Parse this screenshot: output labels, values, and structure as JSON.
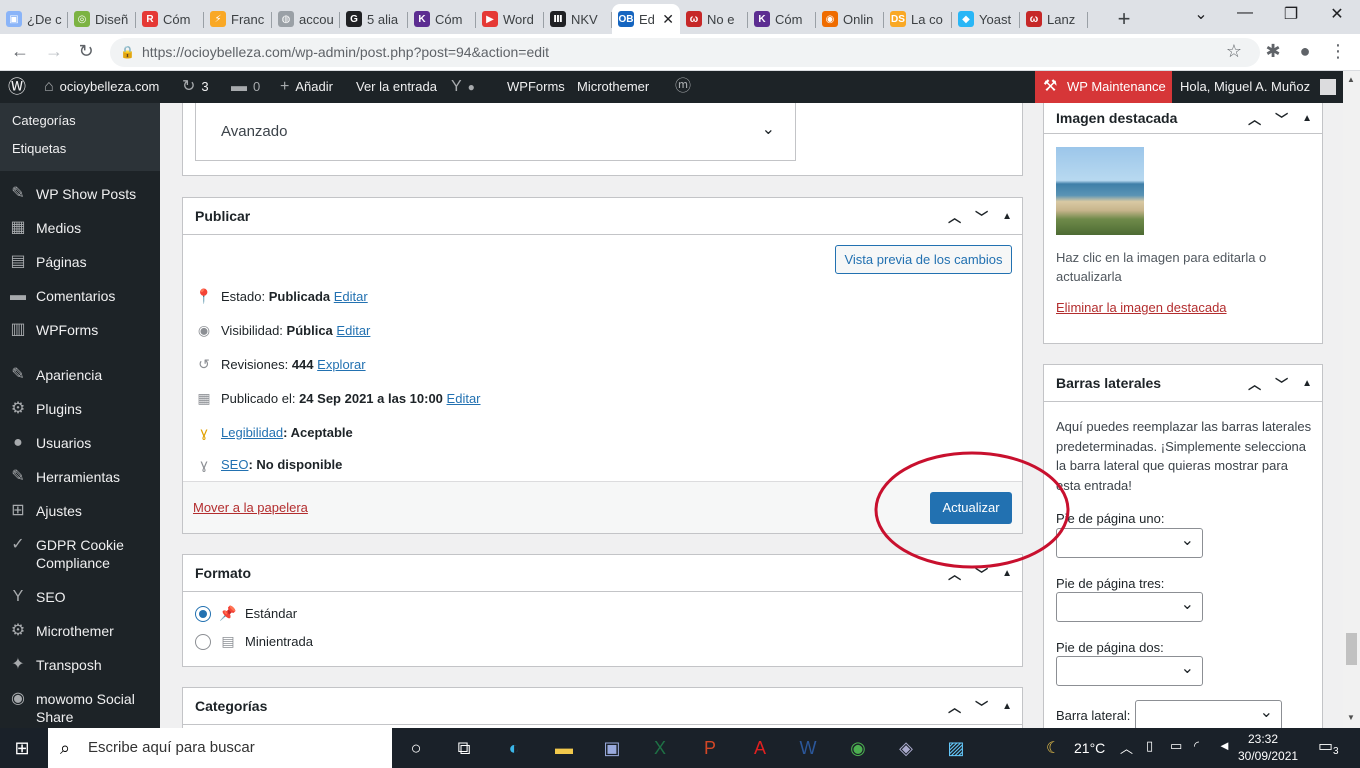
{
  "browser": {
    "tabs": [
      {
        "favicon_color": "#8ab4f8",
        "favicon_char": "▣",
        "title": "¿De c"
      },
      {
        "favicon_color": "#7cb342",
        "favicon_char": "◎",
        "title": "Diseñ"
      },
      {
        "favicon_color": "#e53935",
        "favicon_char": "R",
        "title": "Cóm"
      },
      {
        "favicon_color": "#f9a825",
        "favicon_char": "⚡",
        "title": "Franc"
      },
      {
        "favicon_color": "#9aa0a6",
        "favicon_char": "◍",
        "title": "accou"
      },
      {
        "favicon_color": "#202124",
        "favicon_char": "G",
        "title": "5 alia"
      },
      {
        "favicon_color": "#5c2d91",
        "favicon_char": "K",
        "title": "Cóm"
      },
      {
        "favicon_color": "#e53935",
        "favicon_char": "▶",
        "title": "Word"
      },
      {
        "favicon_color": "#202124",
        "favicon_char": "Ⅲ",
        "title": "NKV"
      },
      {
        "favicon_color": "#1565c0",
        "favicon_char": "OB",
        "title": "Ed"
      },
      {
        "favicon_color": "#c62828",
        "favicon_char": "ω",
        "title": "No e"
      },
      {
        "favicon_color": "#5c2d91",
        "favicon_char": "K",
        "title": "Cóm"
      },
      {
        "favicon_color": "#ef6c00",
        "favicon_char": "◉",
        "title": "Onlin"
      },
      {
        "favicon_color": "#f9a825",
        "favicon_char": "DS",
        "title": "La co"
      },
      {
        "favicon_color": "#29b6f6",
        "favicon_char": "◆",
        "title": "Yoast"
      },
      {
        "favicon_color": "#c62828",
        "favicon_char": "ω",
        "title": "Lanz"
      }
    ],
    "url": "https://ocioybelleza.com/wp-admin/post.php?post=94&action=edit"
  },
  "adminbar": {
    "site": "ocioybelleza.com",
    "updates": "3",
    "comments": "0",
    "add_new": "Añadir",
    "view_post": "Ver la entrada",
    "wpforms": "WPForms",
    "microthemer": "Microthemer",
    "maintenance": "WP Maintenance",
    "greeting": "Hola, Miguel A. Muñoz"
  },
  "sidebar": {
    "submenu": [
      "Categorías",
      "Etiquetas"
    ],
    "items": [
      {
        "icon": "✎",
        "label": "WP Show Posts"
      },
      {
        "icon": "▦",
        "label": "Medios"
      },
      {
        "icon": "▤",
        "label": "Páginas"
      },
      {
        "icon": "▬",
        "label": "Comentarios"
      },
      {
        "icon": "▥",
        "label": "WPForms"
      },
      {
        "icon": "✎",
        "label": "Apariencia"
      },
      {
        "icon": "⚙",
        "label": "Plugins"
      },
      {
        "icon": "●",
        "label": "Usuarios"
      },
      {
        "icon": "✎",
        "label": "Herramientas"
      },
      {
        "icon": "⊞",
        "label": "Ajustes"
      },
      {
        "icon": "✓",
        "label": "GDPR Cookie Compliance"
      },
      {
        "icon": "Y",
        "label": "SEO"
      },
      {
        "icon": "⚙",
        "label": "Microthemer"
      },
      {
        "icon": "✦",
        "label": "Transposh"
      },
      {
        "icon": "◉",
        "label": "mowomo Social Share"
      }
    ]
  },
  "advanced": {
    "label": "Avanzado"
  },
  "publish": {
    "title": "Publicar",
    "preview_button": "Vista previa de los cambios",
    "status_label": "Estado:",
    "status_value": "Publicada",
    "status_edit": "Editar",
    "visibility_label": "Visibilidad:",
    "visibility_value": "Pública",
    "visibility_edit": "Editar",
    "revisions_label": "Revisiones:",
    "revisions_value": "444",
    "revisions_link": "Explorar",
    "published_label": "Publicado el:",
    "published_value": "24 Sep 2021 a las 10:00",
    "published_edit": "Editar",
    "readability_link": "Legibilidad",
    "readability_value": ": Aceptable",
    "seo_link": "SEO",
    "seo_value": ": No disponible",
    "trash_link": "Mover a la papelera",
    "update_button": "Actualizar"
  },
  "format": {
    "title": "Formato",
    "options": [
      "Estándar",
      "Minientrada"
    ],
    "selected": "Estándar"
  },
  "categories": {
    "title": "Categorías"
  },
  "featured_image": {
    "title": "Imagen destacada",
    "hint": "Haz clic en la imagen para editarla o actualizarla",
    "remove_link": "Eliminar la imagen destacada"
  },
  "sidebars_box": {
    "title": "Barras laterales",
    "description": "Aquí puedes reemplazar las barras laterales predeterminadas. ¡Simplemente selecciona la barra lateral que quieras mostrar para esta entrada!",
    "fields": [
      "Pie de página uno:",
      "Pie de página tres:",
      "Pie de página dos:",
      "Barra lateral:"
    ]
  },
  "taskbar": {
    "search_placeholder": "Escribe aquí para buscar",
    "temperature": "21°C",
    "time": "23:32",
    "date": "30/09/2021",
    "notifications": "3"
  },
  "colors": {
    "wp_blue": "#2271b1",
    "adminbar": "#1d2327",
    "annotation_red": "#c8102e"
  }
}
